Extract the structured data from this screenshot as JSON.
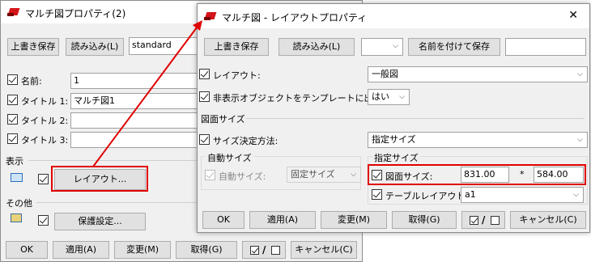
{
  "back": {
    "title": "マルチ図プロパティ(2)",
    "save_label": "上書き保存",
    "load_label": "読み込み(L)",
    "preset_value": "standard",
    "name_label": "名前:",
    "name_value": "1",
    "title1_label": "タイトル 1:",
    "title1_value": "マルチ図1",
    "title2_label": "タイトル 2:",
    "title3_label": "タイトル 3:",
    "display_section": "表示",
    "layout_button": "レイアウト...",
    "other_section": "その他",
    "protect_button": "保護設定...",
    "ok_label": "OK",
    "apply_label": "適用(A)",
    "change_label": "変更(M)",
    "get_label": "取得(G)",
    "toggle_label": "/",
    "cancel_label": "キャンセル(C)"
  },
  "front": {
    "title": "マルチ図 - レイアウトプロパティ",
    "close_glyph": "✕",
    "save_label": "上書き保存",
    "load_label": "読み込み(L)",
    "save_as_label": "名前を付けて保存",
    "layout_label": "レイアウト:",
    "layout_value": "一般図",
    "hidden_label": "非表示オブジェクトをテンプレートに出力",
    "hidden_value": "はい",
    "sheet_size_section": "図面サイズ",
    "size_method_label": "サイズ決定方法:",
    "size_method_value": "指定サイズ",
    "auto_group": "自動サイズ",
    "auto_label": "自動サイズ:",
    "auto_value": "固定サイズ",
    "specified_group": "指定サイズ",
    "sheet_size_label": "図面サイズ:",
    "width_value": "831.00",
    "times": "*",
    "height_value": "584.00",
    "table_layout_label": "テーブルレイアウト:",
    "table_layout_value": "a1",
    "ok_label": "OK",
    "apply_label": "適用(A)",
    "change_label": "変更(M)",
    "get_label": "取得(G)",
    "toggle_label": "/",
    "cancel_label": "キャンセル(C)"
  },
  "colors": {
    "annotation_red": "#e00000",
    "window_bg": "#f0f0f0",
    "button_bg": "#e1e1e1"
  }
}
